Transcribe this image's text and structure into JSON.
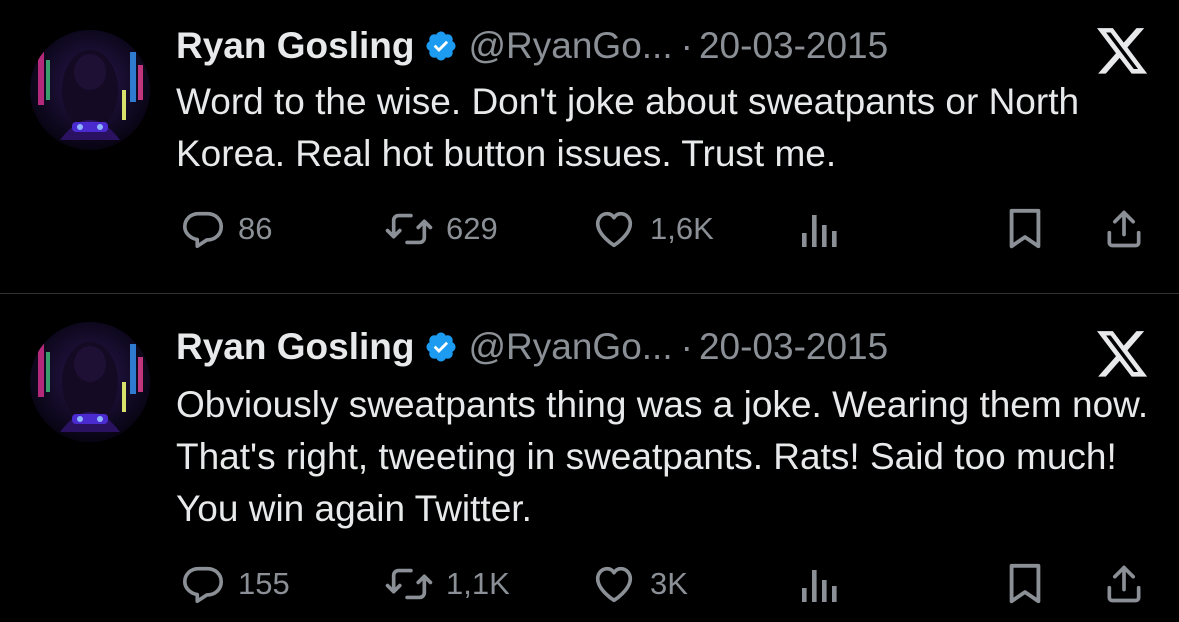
{
  "tweets": [
    {
      "author_name": "Ryan Gosling",
      "handle": "@RyanGo...",
      "separator": "·",
      "date": "20-03-2015",
      "text": "Word to the wise. Don't joke about sweatpants or North Korea. Real hot button issues. Trust me.",
      "replies": "86",
      "reposts": "629",
      "likes": "1,6K"
    },
    {
      "author_name": "Ryan Gosling",
      "handle": "@RyanGo...",
      "separator": "·",
      "date": "20-03-2015",
      "text": "Obviously sweatpants thing was a joke. Wearing them now. That's right, tweeting in sweatpants. Rats! Said too much! You win again Twitter.",
      "replies": "155",
      "reposts": "1,1K",
      "likes": "3K"
    }
  ],
  "icons": {
    "verified": "verified-badge-icon",
    "platform": "x-logo-icon",
    "reply": "reply-icon",
    "repost": "repost-icon",
    "like": "heart-icon",
    "views": "views-icon",
    "bookmark": "bookmark-icon",
    "share": "share-icon"
  },
  "colors": {
    "background": "#000000",
    "text": "#e7e9ea",
    "secondary_text": "#8b9096",
    "verified_blue": "#1d9bf0",
    "divider": "#2f3336"
  }
}
